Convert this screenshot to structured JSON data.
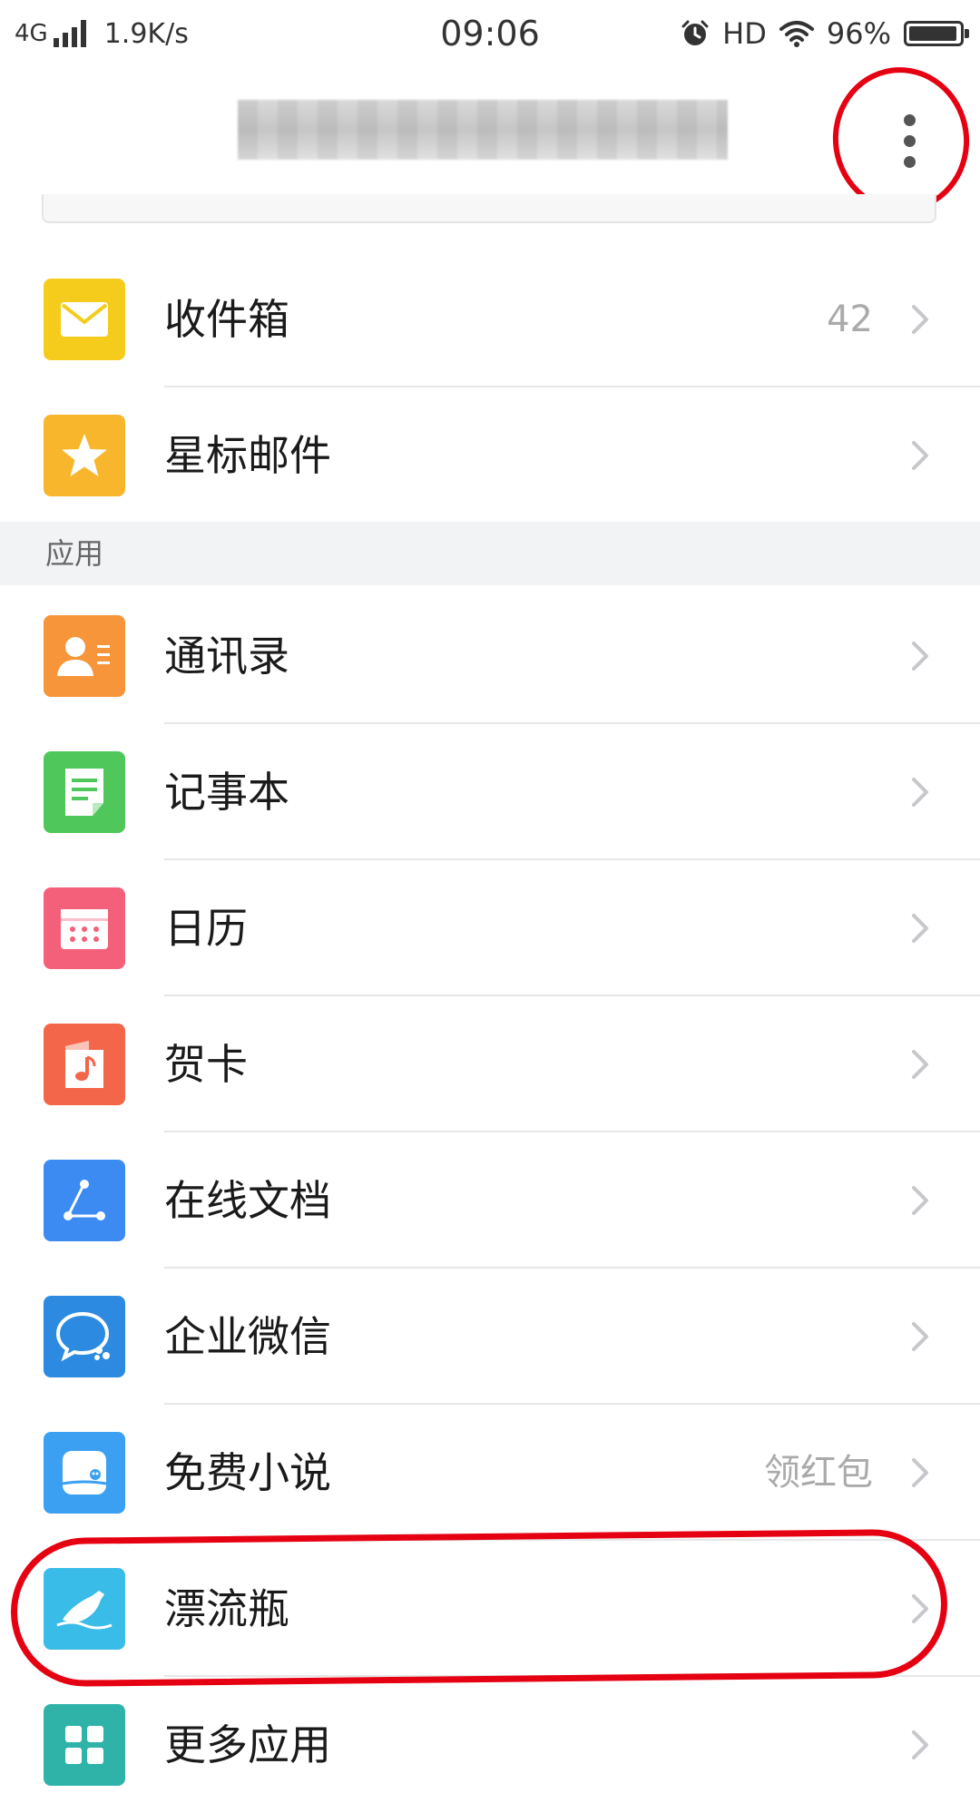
{
  "status_bar": {
    "network": "4G",
    "speed": "1.9K/s",
    "time": "09:06",
    "hd": "HD",
    "battery_text": "96%",
    "battery_level": 0.96
  },
  "header": {
    "more_icon": "more-vertical-icon"
  },
  "mail": [
    {
      "label": "收件箱",
      "extra": "42",
      "icon": "mail-icon",
      "color": "#F5CC1C"
    },
    {
      "label": "星标邮件",
      "extra": "",
      "icon": "star-icon",
      "color": "#F8B62C"
    }
  ],
  "section": {
    "title": "应用"
  },
  "apps": [
    {
      "label": "通讯录",
      "extra": "",
      "icon": "contacts-icon",
      "color": "#F7953B"
    },
    {
      "label": "记事本",
      "extra": "",
      "icon": "notebook-icon",
      "color": "#4FC75B"
    },
    {
      "label": "日历",
      "extra": "",
      "icon": "calendar-icon",
      "color": "#F4607A"
    },
    {
      "label": "贺卡",
      "extra": "",
      "icon": "greeting-card-icon",
      "color": "#F4664A"
    },
    {
      "label": "在线文档",
      "extra": "",
      "icon": "online-docs-icon",
      "color": "#3B8BF2"
    },
    {
      "label": "企业微信",
      "extra": "",
      "icon": "wecom-icon",
      "color": "#2C8BE0"
    },
    {
      "label": "免费小说",
      "extra": "领红包",
      "icon": "novel-icon",
      "color": "#3BA0F2"
    },
    {
      "label": "漂流瓶",
      "extra": "",
      "icon": "drift-bottle-icon",
      "color": "#3ABCE8"
    },
    {
      "label": "更多应用",
      "extra": "",
      "icon": "more-apps-icon",
      "color": "#2FB3A9"
    }
  ],
  "colors": {
    "annotation": "#E50012",
    "section_bg": "#F2F3F5",
    "chevron": "#C7C7CC"
  }
}
